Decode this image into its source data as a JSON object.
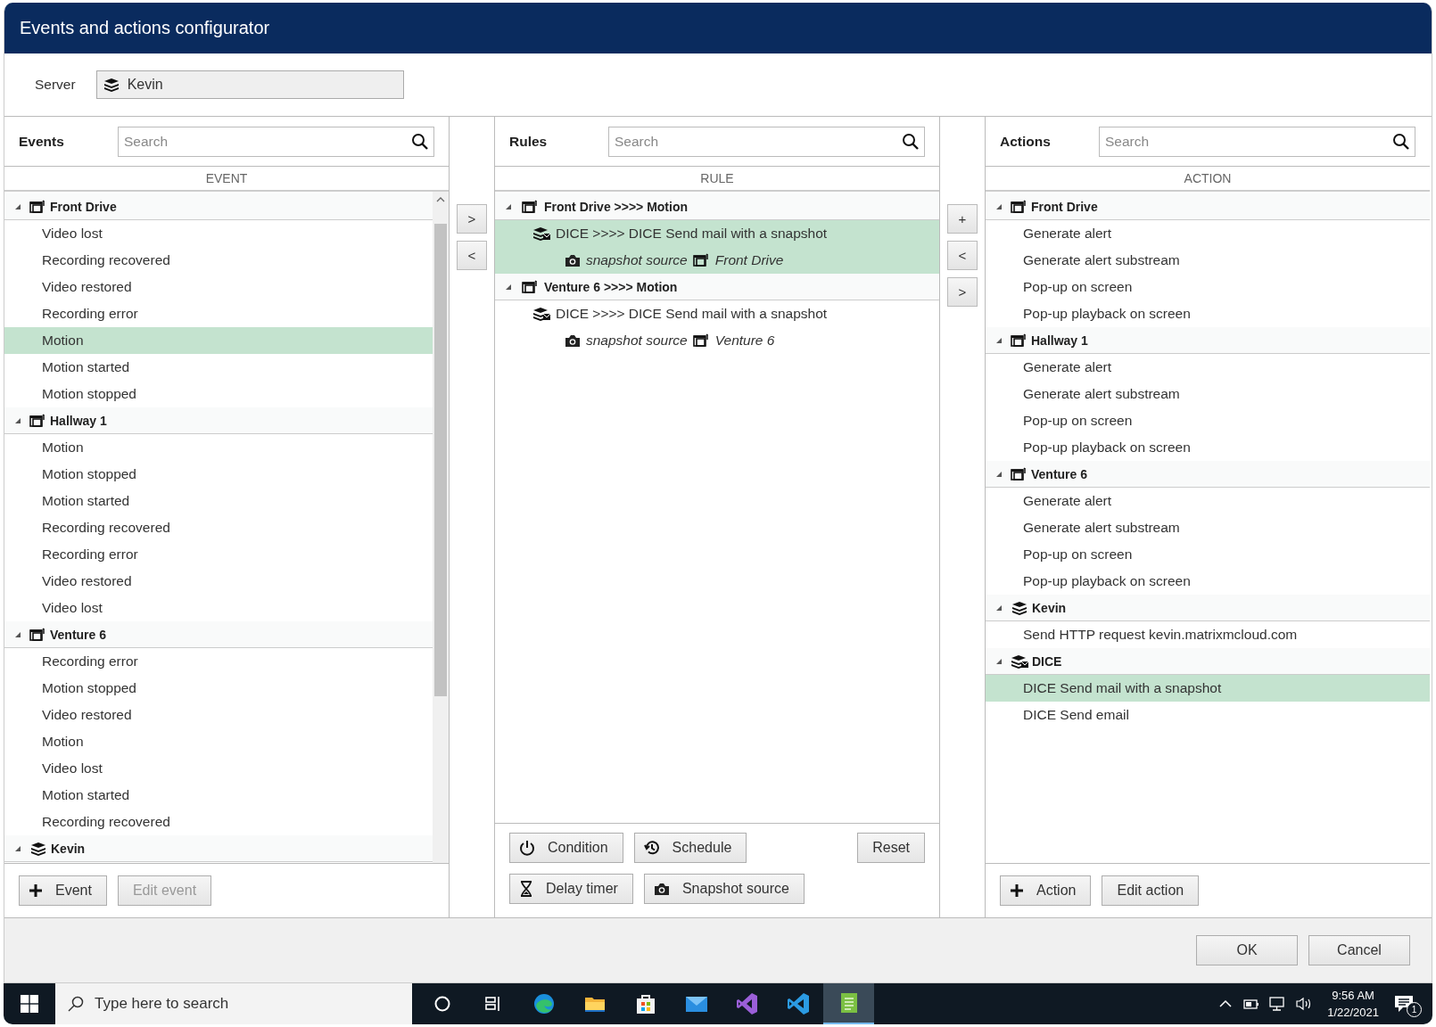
{
  "window": {
    "title": "Events and actions configurator"
  },
  "server": {
    "label": "Server",
    "value": "Kevin"
  },
  "move_buttons_left": [
    ">",
    "<"
  ],
  "move_buttons_right": [
    "+",
    "<",
    ">"
  ],
  "events": {
    "title": "Events",
    "search": {
      "placeholder": "Search"
    },
    "column": "EVENT",
    "groups": [
      {
        "label": "Front Drive",
        "kind": "camera",
        "items": [
          {
            "label": "Video lost",
            "selected": false
          },
          {
            "label": "Recording recovered",
            "selected": false
          },
          {
            "label": "Video restored",
            "selected": false
          },
          {
            "label": "Recording error",
            "selected": false
          },
          {
            "label": "Motion",
            "selected": true
          },
          {
            "label": "Motion started",
            "selected": false
          },
          {
            "label": "Motion stopped",
            "selected": false
          }
        ]
      },
      {
        "label": "Hallway 1",
        "kind": "camera",
        "items": [
          {
            "label": "Motion",
            "selected": false
          },
          {
            "label": "Motion stopped",
            "selected": false
          },
          {
            "label": "Motion started",
            "selected": false
          },
          {
            "label": "Recording recovered",
            "selected": false
          },
          {
            "label": "Recording error",
            "selected": false
          },
          {
            "label": "Video restored",
            "selected": false
          },
          {
            "label": "Video lost",
            "selected": false
          }
        ]
      },
      {
        "label": "Venture 6",
        "kind": "camera",
        "items": [
          {
            "label": "Recording error",
            "selected": false
          },
          {
            "label": "Motion stopped",
            "selected": false
          },
          {
            "label": "Video restored",
            "selected": false
          },
          {
            "label": "Motion",
            "selected": false
          },
          {
            "label": "Video lost",
            "selected": false
          },
          {
            "label": "Motion started",
            "selected": false
          },
          {
            "label": "Recording recovered",
            "selected": false
          }
        ]
      },
      {
        "label": "Kevin",
        "kind": "server"
      }
    ],
    "buttons": [
      {
        "label": "Event",
        "kind": "add",
        "disabled": false
      },
      {
        "label": "Edit event",
        "kind": "plain",
        "disabled": true
      }
    ]
  },
  "rules": {
    "title": "Rules",
    "search": {
      "placeholder": "Search"
    },
    "column": "RULE",
    "groups": [
      {
        "label": "Front Drive >>>> Motion",
        "kind": "camera",
        "actions": [
          {
            "label": "DICE >>>> DICE Send mail with a snapshot",
            "selected": true,
            "source_label": "snapshot source",
            "source": "Front Drive"
          }
        ]
      },
      {
        "label": "Venture 6 >>>> Motion",
        "kind": "camera",
        "actions": [
          {
            "label": "DICE >>>> DICE Send mail with a snapshot",
            "selected": false,
            "source_label": "snapshot source",
            "source": "Venture 6"
          }
        ]
      }
    ],
    "button_rows": [
      [
        {
          "label": "Condition",
          "kind": "condition"
        },
        {
          "label": "Schedule",
          "kind": "schedule"
        }
      ],
      [
        {
          "label": "Delay timer",
          "kind": "delay"
        },
        {
          "label": "Snapshot source",
          "kind": "snapshot"
        }
      ]
    ],
    "reset_button": "Reset"
  },
  "actions": {
    "title": "Actions",
    "search": {
      "placeholder": "Search"
    },
    "column": "ACTION",
    "groups": [
      {
        "label": "Front Drive",
        "kind": "camera",
        "items": [
          {
            "label": "Generate alert",
            "selected": false
          },
          {
            "label": "Generate alert substream",
            "selected": false
          },
          {
            "label": "Pop-up on screen",
            "selected": false
          },
          {
            "label": "Pop-up playback on screen",
            "selected": false
          }
        ]
      },
      {
        "label": "Hallway 1",
        "kind": "camera",
        "items": [
          {
            "label": "Generate alert",
            "selected": false
          },
          {
            "label": "Generate alert substream",
            "selected": false
          },
          {
            "label": "Pop-up on screen",
            "selected": false
          },
          {
            "label": "Pop-up playback on screen",
            "selected": false
          }
        ]
      },
      {
        "label": "Venture 6",
        "kind": "camera",
        "items": [
          {
            "label": "Generate alert",
            "selected": false
          },
          {
            "label": "Generate alert substream",
            "selected": false
          },
          {
            "label": "Pop-up on screen",
            "selected": false
          },
          {
            "label": "Pop-up playback on screen",
            "selected": false
          }
        ]
      },
      {
        "label": "Kevin",
        "kind": "server",
        "items": [
          {
            "label": "Send HTTP request kevin.matrixmcloud.com",
            "selected": false
          }
        ]
      },
      {
        "label": "DICE",
        "kind": "mail-server",
        "items": [
          {
            "label": "DICE Send mail with a snapshot",
            "selected": true
          },
          {
            "label": "DICE Send email",
            "selected": false
          }
        ]
      }
    ],
    "buttons": [
      {
        "label": "Action",
        "kind": "add",
        "disabled": false
      },
      {
        "label": "Edit action",
        "kind": "plain",
        "disabled": false
      }
    ]
  },
  "dialog_buttons": [
    "OK",
    "Cancel"
  ],
  "taskbar": {
    "search_placeholder": "Type here to search",
    "apps": [
      {
        "kind": "cortana",
        "active": false
      },
      {
        "kind": "taskview",
        "active": false
      },
      {
        "kind": "edge",
        "active": false
      },
      {
        "kind": "folder",
        "active": false
      },
      {
        "kind": "store",
        "active": false
      },
      {
        "kind": "mail",
        "active": false
      },
      {
        "kind": "vs",
        "active": false
      },
      {
        "kind": "vscode",
        "active": false
      },
      {
        "kind": "notes",
        "active": true
      }
    ],
    "time": "9:56 AM",
    "date": "1/22/2021",
    "notification_count": "1"
  }
}
